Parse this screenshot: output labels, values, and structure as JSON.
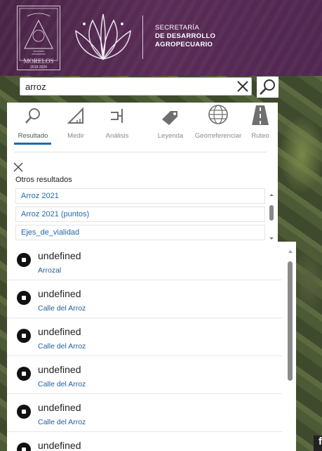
{
  "header": {
    "crest_text": "MORELOS",
    "crest_year": "2018-2024",
    "secretaria": "SECRETARÍA",
    "line2": "DE DESARROLLO",
    "line3": "AGROPECUARIO"
  },
  "search": {
    "value": "arroz",
    "clear_icon": "close-icon",
    "search_icon": "search-icon"
  },
  "tools": {
    "tabs": [
      {
        "label": "Resultado",
        "icon": "search-icon",
        "active": true
      },
      {
        "label": "Medir",
        "icon": "ruler-icon",
        "active": false
      },
      {
        "label": "Análisis",
        "icon": "analysis-icon",
        "active": false
      },
      {
        "label": "Leyenda",
        "icon": "tag-icon",
        "active": false
      },
      {
        "label": "Georreferenciar",
        "icon": "globe-icon",
        "active": false
      },
      {
        "label": "Ruteo",
        "icon": "road-icon",
        "active": false
      }
    ],
    "otros_title": "Otros resultados",
    "results": [
      "Arroz 2021",
      "Arroz 2021 (puntos)",
      "Ejes_de_vialidad"
    ]
  },
  "features": [
    {
      "name": "undefined",
      "sub": "Arrozal"
    },
    {
      "name": "undefined",
      "sub": "Calle del Arroz"
    },
    {
      "name": "undefined",
      "sub": "Calle del Arroz"
    },
    {
      "name": "undefined",
      "sub": "Calle del Arroz"
    },
    {
      "name": "undefined",
      "sub": "Calle del Arroz"
    },
    {
      "name": "undefined",
      "sub": ""
    }
  ],
  "social": {
    "facebook_letter": "f"
  },
  "colors": {
    "header": "#4f2750",
    "accent": "#1f6aa8"
  }
}
